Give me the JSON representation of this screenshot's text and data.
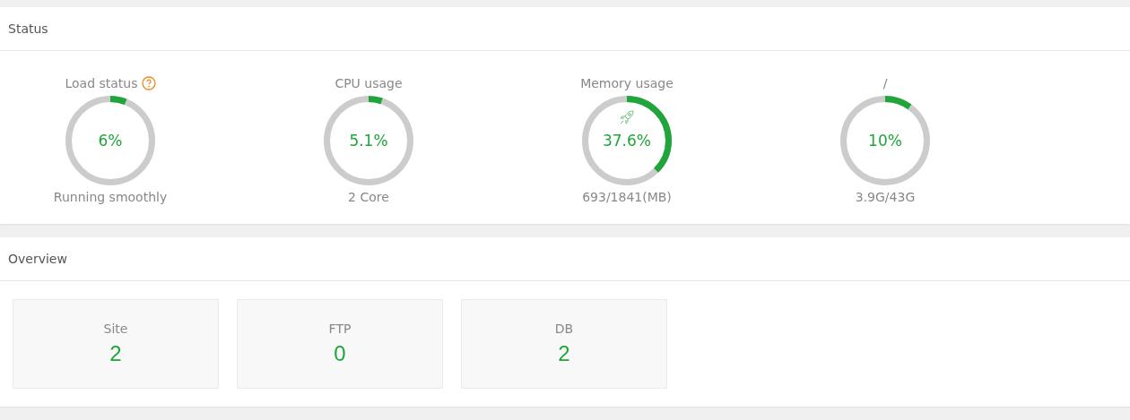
{
  "status": {
    "title": "Status",
    "gauges": [
      {
        "label": "Load status",
        "help": true,
        "rocket": false,
        "value": "6%",
        "level": 0.06,
        "footer": "Running smoothly"
      },
      {
        "label": "CPU usage",
        "help": false,
        "rocket": false,
        "value": "5.1%",
        "level": 0.051,
        "footer": "2 Core"
      },
      {
        "label": "Memory usage",
        "help": false,
        "rocket": true,
        "value": "37.6%",
        "level": 0.376,
        "footer": "693/1841(MB)"
      },
      {
        "label": "/",
        "help": false,
        "rocket": false,
        "value": "10%",
        "level": 0.1,
        "footer": "3.9G/43G"
      }
    ]
  },
  "overview": {
    "title": "Overview",
    "cards": [
      {
        "label": "Site",
        "value": "2"
      },
      {
        "label": "FTP",
        "value": "0"
      },
      {
        "label": "DB",
        "value": "2"
      }
    ]
  }
}
